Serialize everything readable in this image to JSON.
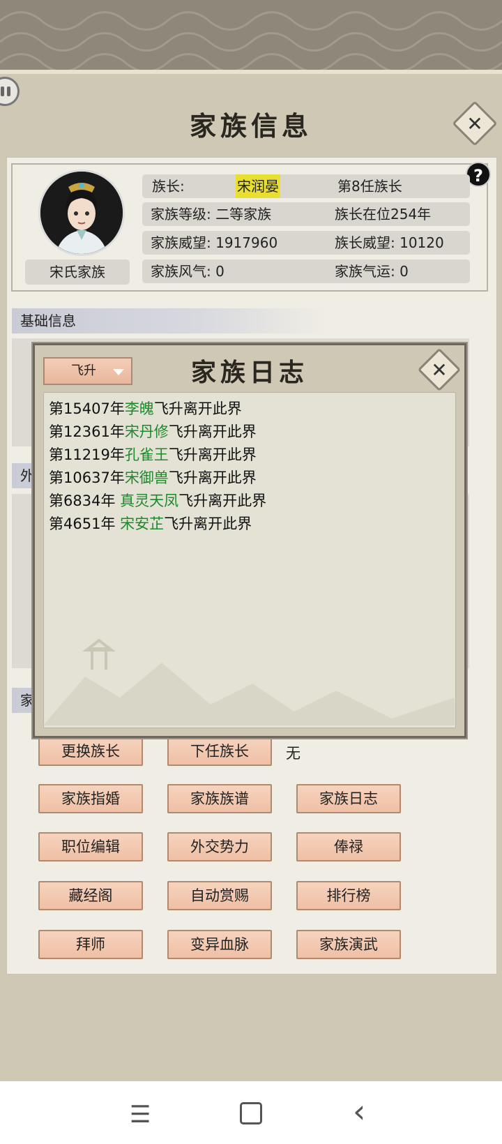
{
  "window": {
    "title": "家族信息"
  },
  "family": {
    "clan_name": "宋氏家族",
    "leader_label": "族长:",
    "leader_name": "宋润晏",
    "leader_generation": "第8任族长",
    "rank": "家族等级: 二等家族",
    "tenure": "族长在位254年",
    "clan_prestige": "家族威望: 1917960",
    "leader_prestige": "族长威望: 10120",
    "clan_style": "家族风气: 0",
    "clan_fortune": "家族气运: 0"
  },
  "help": {
    "label": "?"
  },
  "sections": {
    "basic": "基础信息",
    "foreign": "外",
    "clan": "家"
  },
  "succession": {
    "change_leader": "更换族长",
    "next_leader": "下任族长",
    "next_leader_value": "无"
  },
  "actions": [
    [
      "家族指婚",
      "家族族谱",
      "家族日志"
    ],
    [
      "职位编辑",
      "外交势力",
      "俸禄"
    ],
    [
      "藏经阁",
      "自动赏赐",
      "排行榜"
    ],
    [
      "拜师",
      "变异血脉",
      "家族演武"
    ]
  ],
  "modal": {
    "title": "家族日志",
    "filter_selected": "飞升",
    "entries": [
      {
        "year": "第15407年",
        "name": "李魄",
        "event": "飞升离开此界"
      },
      {
        "year": "第12361年",
        "name": "宋丹修",
        "event": "飞升离开此界"
      },
      {
        "year": "第11219年",
        "name": "孔雀王",
        "event": "飞升离开此界"
      },
      {
        "year": "第10637年",
        "name": "宋御兽",
        "event": "飞升离开此界"
      },
      {
        "year": "第6834年 ",
        "name": "真灵天凤",
        "event": "飞升离开此界"
      },
      {
        "year": "第4651年 ",
        "name": "宋安芷",
        "event": "飞升离开此界"
      }
    ]
  },
  "nav": {
    "menu": "☰",
    "home": "▢",
    "back": "‹"
  },
  "colors": {
    "name_green": "#1b8a2b",
    "button_peach": "#f2c8af",
    "leader_highlight": "#e8df30"
  }
}
